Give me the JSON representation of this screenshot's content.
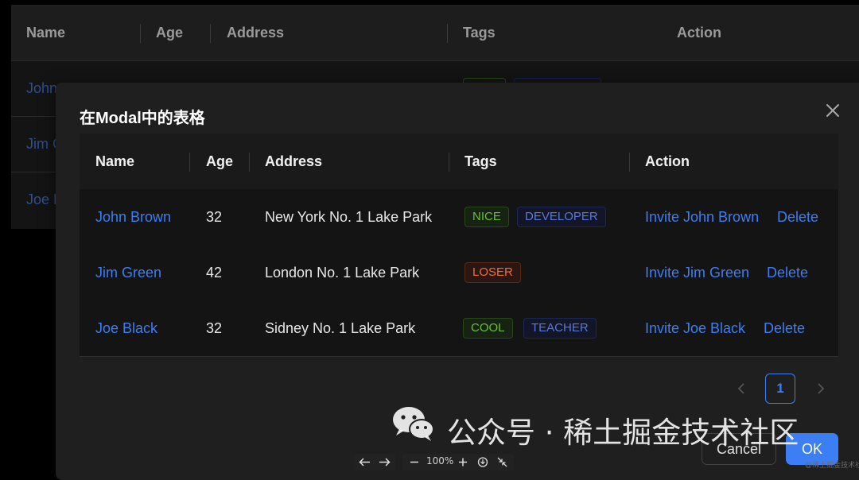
{
  "background_table": {
    "columns": [
      "Name",
      "Age",
      "Address",
      "Tags",
      "Action"
    ],
    "rows": [
      "John",
      "Jim G",
      "Joe B"
    ]
  },
  "modal": {
    "title": "在Modal中的表格",
    "close_icon": "close-icon",
    "columns": [
      "Name",
      "Age",
      "Address",
      "Tags",
      "Action"
    ],
    "rows": [
      {
        "name": "John Brown",
        "age": "32",
        "address": "New York No. 1 Lake Park",
        "tags": [
          {
            "label": "NICE",
            "color": "green"
          },
          {
            "label": "DEVELOPER",
            "color": "geekblue"
          }
        ],
        "invite": "Invite John Brown",
        "delete": "Delete"
      },
      {
        "name": "Jim Green",
        "age": "42",
        "address": "London No. 1 Lake Park",
        "tags": [
          {
            "label": "LOSER",
            "color": "volcano"
          }
        ],
        "invite": "Invite Jim Green",
        "delete": "Delete"
      },
      {
        "name": "Joe Black",
        "age": "32",
        "address": "Sidney No. 1 Lake Park",
        "tags": [
          {
            "label": "COOL",
            "color": "green"
          },
          {
            "label": "TEACHER",
            "color": "geekblue"
          }
        ],
        "invite": "Invite Joe Black",
        "delete": "Delete"
      }
    ],
    "pagination": {
      "current_page": "1",
      "prev_icon": "chevron-left-icon",
      "next_icon": "chevron-right-icon"
    },
    "footer": {
      "cancel_label": "Cancel",
      "ok_label": "OK"
    }
  },
  "watermark": {
    "text": "公众号 · 稀土掘金技术社区",
    "small_text": "@稀土掘金技术社区",
    "icon": "wechat-icon"
  },
  "viewer_toolbar": {
    "zoom": "100%"
  },
  "colors": {
    "link": "#3c7ef4",
    "primary": "#3c7ef4",
    "modal_bg": "#1f1f1f",
    "page_bg": "#000000"
  }
}
